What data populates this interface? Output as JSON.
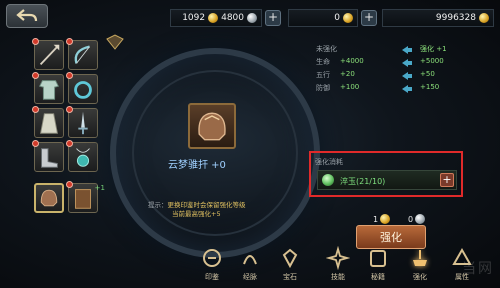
{
  "topbar": {
    "gold": "1092",
    "gold_extra": "4800",
    "diamond": "0",
    "silver": "9996328"
  },
  "equipment_slots": [
    {
      "name": "spear",
      "badge": true
    },
    {
      "name": "bow",
      "badge": true
    },
    {
      "name": "armor",
      "badge": true
    },
    {
      "name": "ring",
      "badge": true
    },
    {
      "name": "robe",
      "badge": true
    },
    {
      "name": "sword",
      "badge": true
    },
    {
      "name": "boots",
      "badge": true
    },
    {
      "name": "pendant",
      "badge": true
    },
    {
      "name": "helmet",
      "selected": true
    },
    {
      "name": "book",
      "level": "+1"
    }
  ],
  "item": {
    "name": "云梦骓扞 +0"
  },
  "tip": {
    "line1_prefix": "提示：",
    "line1": "更换印鉴时会保留强化等级",
    "line2": "当前最高强化+5"
  },
  "stats": {
    "header_left": "未强化",
    "header_right": "强化 +1",
    "rows": [
      {
        "label": "生命",
        "from": "+4000",
        "to": "+5000"
      },
      {
        "label": "五行",
        "from": "+20",
        "to": "+50"
      },
      {
        "label": "防御",
        "from": "+100",
        "to": "+150"
      }
    ]
  },
  "cost": {
    "title": "强化消耗",
    "material": "淬玉(21/10)"
  },
  "bottom": {
    "cost_gold": "1",
    "cost_silver": "0",
    "strengthen_label": "强化"
  },
  "tabs": [
    {
      "label": "印鉴",
      "icon": "seal-icon"
    },
    {
      "label": "经脉",
      "icon": "meridian-icon"
    },
    {
      "label": "宝石",
      "icon": "gem-icon"
    },
    {
      "label": "技能",
      "icon": "skill-icon"
    },
    {
      "label": "秘籍",
      "icon": "scroll-icon"
    },
    {
      "label": "强化",
      "icon": "forge-icon",
      "active": true
    },
    {
      "label": "属性",
      "icon": "attribute-icon"
    }
  ],
  "watermark": "当网",
  "colors": {
    "accent_red": "#e02a2a",
    "stat_green": "#8be07a",
    "item_name_blue": "#9fd0ff"
  }
}
